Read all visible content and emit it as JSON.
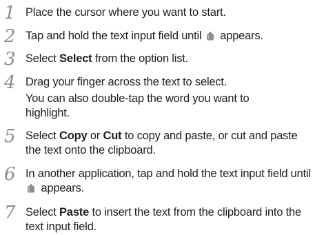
{
  "steps": [
    {
      "number": "1",
      "text": "Place the cursor where you want to start."
    },
    {
      "number": "2",
      "before": "Tap and hold the text input field until",
      "marker_icon": "text-cursor-marker-icon",
      "after": "appears."
    },
    {
      "number": "3",
      "before": "Select ",
      "bold": "Select",
      "after": " from the option list."
    },
    {
      "number": "4",
      "line1": "Drag your finger across the text to select.",
      "line2": "You can also double-tap the word you want to highlight."
    },
    {
      "number": "5",
      "before": "Select ",
      "bold1": "Copy",
      "middle": " or ",
      "bold2": "Cut",
      "after": " to copy and paste, or cut and paste the text onto the clipboard."
    },
    {
      "number": "6",
      "before": "In another application, tap and hold the text input field until",
      "marker_icon": "text-cursor-marker-icon",
      "after": "appears."
    },
    {
      "number": "7",
      "before": "Select ",
      "bold": "Paste",
      "after": " to insert the text from the clipboard into the text input field."
    }
  ],
  "colors": {
    "step_number": "#8a8a8a",
    "text": "#1e1e1e",
    "marker": "#8c8c8c"
  }
}
